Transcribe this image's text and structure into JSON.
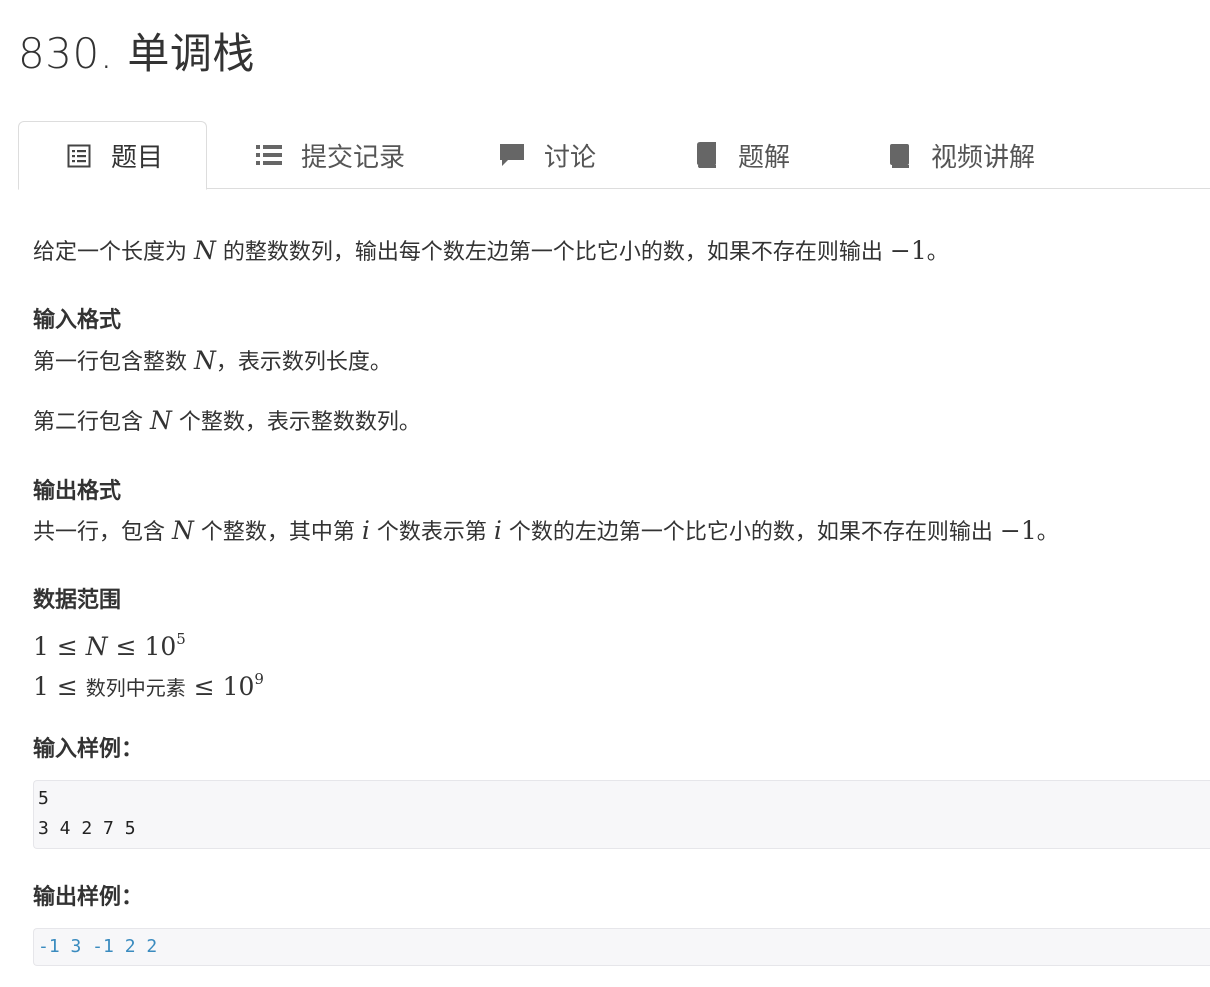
{
  "problem": {
    "title": "830. 单调栈"
  },
  "tabs": [
    {
      "label": "题目",
      "icon": "document-list-icon",
      "active": true
    },
    {
      "label": "提交记录",
      "icon": "list-icon",
      "active": false
    },
    {
      "label": "讨论",
      "icon": "comment-icon",
      "active": false
    },
    {
      "label": "题解",
      "icon": "book-icon",
      "active": false
    },
    {
      "label": "视频讲解",
      "icon": "book-icon",
      "active": false
    }
  ],
  "statement": {
    "desc_a": "给定一个长度为 ",
    "desc_b": " 的整数数列，输出每个数左边第一个比它小的数，如果不存在则输出 ",
    "desc_c": "。",
    "var_N": "N",
    "var_i": "i",
    "neg_one": "−1",
    "input_heading": "输入格式",
    "input_line1_a": "第一行包含整数 ",
    "input_line1_b": "，表示数列长度。",
    "input_line2_a": "第二行包含 ",
    "input_line2_b": " 个整数，表示整数数列。",
    "output_heading": "输出格式",
    "output_a": "共一行，包含 ",
    "output_b": " 个整数，其中第 ",
    "output_c": " 个数表示第 ",
    "output_d": " 个数的左边第一个比它小的数，如果不存在则输出 ",
    "output_e": "。",
    "range_heading": "数据范围",
    "range1_a": "1 ≤ ",
    "range1_b": " ≤ 10",
    "range1_exp": "5",
    "range2_a": "1 ≤ ",
    "range2_word": "数列中元素",
    "range2_b": " ≤ 10",
    "range2_exp": "9",
    "sample_input_heading": "输入样例：",
    "sample_input_lines": [
      "5",
      "3 4 2 7 5"
    ],
    "sample_output_heading": "输出样例：",
    "sample_output_lines": [
      "-1 3 -1 2 2"
    ]
  },
  "colors": {
    "accent_output": "#3a8bbf",
    "code_bg": "#f7f7f9",
    "border": "#dddddd"
  }
}
